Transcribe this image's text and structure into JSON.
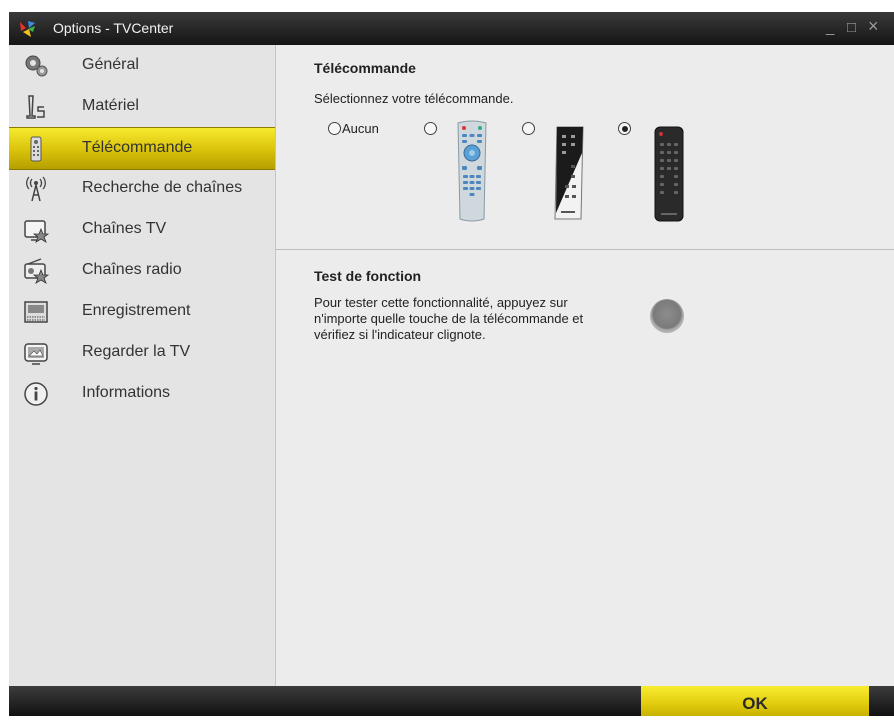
{
  "window": {
    "title": "Options - TVCenter",
    "controls": {
      "minimize": "_",
      "maximize": "□",
      "close": "×"
    }
  },
  "sidebar": {
    "items": [
      {
        "label": "Général",
        "icon": "gears-icon",
        "active": false
      },
      {
        "label": "Matériel",
        "icon": "hardware-icon",
        "active": false
      },
      {
        "label": "Télécommande",
        "icon": "remote-icon",
        "active": true
      },
      {
        "label": "Recherche de chaînes",
        "icon": "antenna-icon",
        "active": false
      },
      {
        "label": "Chaînes TV",
        "icon": "tv-star-icon",
        "active": false
      },
      {
        "label": "Chaînes radio",
        "icon": "radio-star-icon",
        "active": false
      },
      {
        "label": "Enregistrement",
        "icon": "recording-icon",
        "active": false
      },
      {
        "label": "Regarder la TV",
        "icon": "watch-tv-icon",
        "active": false
      },
      {
        "label": "Informations",
        "icon": "info-icon",
        "active": false
      }
    ]
  },
  "remote_section": {
    "title": "Télécommande",
    "prompt": "Sélectionnez votre télécommande.",
    "options": [
      {
        "label": "Aucun",
        "checked": false
      },
      {
        "label": "",
        "checked": false,
        "remote": "silver-remote"
      },
      {
        "label": "",
        "checked": false,
        "remote": "black-white-remote"
      },
      {
        "label": "",
        "checked": true,
        "remote": "black-remote"
      }
    ]
  },
  "function_test": {
    "title": "Test de fonction",
    "line1": "Pour tester cette fonctionnalité, appuyez sur",
    "line2": "n'importe quelle touche de la télécommande et",
    "line3": "vérifiez si l'indicateur clignote."
  },
  "footer": {
    "ok_label": "OK"
  },
  "colors": {
    "accent": "#f2e21b",
    "titlebar": "#1e1e1e",
    "sidebar": "#e4e4e4",
    "content": "#ececec"
  }
}
